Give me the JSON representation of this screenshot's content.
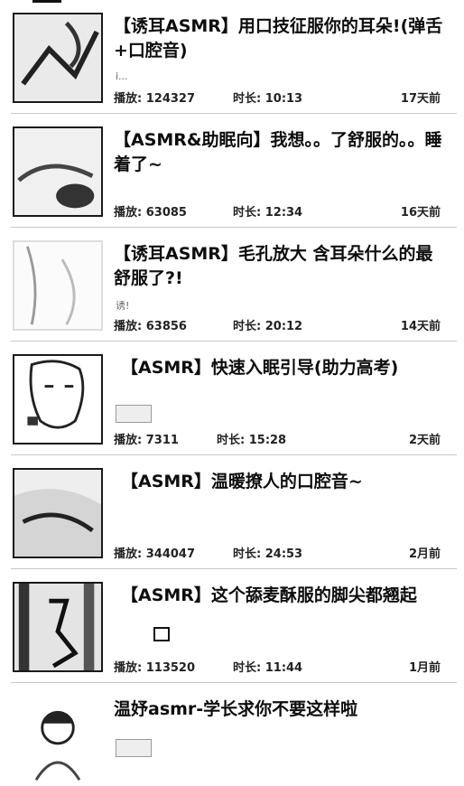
{
  "videos": [
    {
      "title": "【诱耳ASMR】用口技征服你的耳朵!(弹舌+口腔音)",
      "uploader": "i...",
      "plays": "播放: 124327",
      "duration": "时长: 10:13",
      "age": "17天前"
    },
    {
      "title": "【ASMR&助眠向】我想。。了舒服的。。睡着了~",
      "uploader": "",
      "plays": "播放: 63085",
      "duration": "时长: 12:34",
      "age": "16天前"
    },
    {
      "title": "【诱耳ASMR】毛孔放大 含耳朵什么的最舒服了?!",
      "uploader": "诱!",
      "plays": "播放: 63856",
      "duration": "时长: 20:12",
      "age": "14天前"
    },
    {
      "title": "【ASMR】快速入眠引导(助力高考)",
      "uploader": "",
      "plays": "播放: 7311",
      "duration": "时长: 15:28",
      "age": "2天前"
    },
    {
      "title": "【ASMR】温暖撩人的口腔音~",
      "uploader": "",
      "plays": "播放: 344047",
      "duration": "时长: 24:53",
      "age": "2月前"
    },
    {
      "title": "【ASMR】这个舔麦酥服的脚尖都翘起",
      "uploader": "",
      "plays": "播放: 113520",
      "duration": "时长: 11:44",
      "age": "1月前"
    },
    {
      "title": "温妤asmr-学长求你不要这样啦",
      "uploader": "",
      "plays": "",
      "duration": "",
      "age": ""
    }
  ]
}
